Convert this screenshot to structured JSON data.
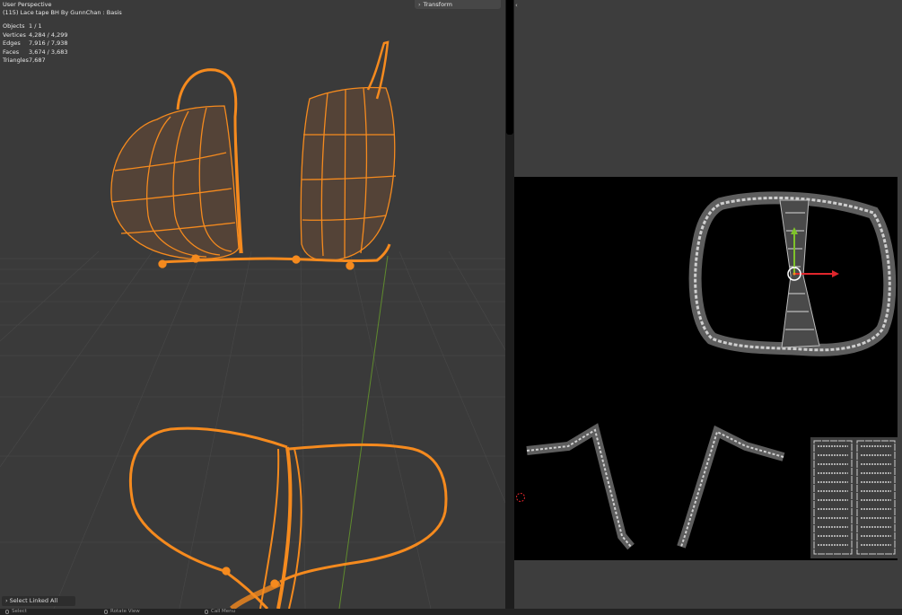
{
  "viewport": {
    "title": "User Perspective",
    "object_line": "(115) Lace tape BH By GunnChan : Basis",
    "stats": [
      {
        "label": "Objects",
        "value": "1 / 1"
      },
      {
        "label": "Vertices",
        "value": "4,284 / 4,299"
      },
      {
        "label": "Edges",
        "value": "7,916 / 7,938"
      },
      {
        "label": "Faces",
        "value": "3,674 / 3,683"
      },
      {
        "label": "Triangles",
        "value": "7,687"
      }
    ],
    "transform_label": "Transform",
    "operator_panel_label": "Select Linked All"
  },
  "uv_editor": {
    "toggle_glyph": "‹",
    "background_color": "#000000"
  },
  "statusbar": {
    "items": [
      {
        "label": "Select"
      },
      {
        "label": "Rotate View"
      },
      {
        "label": "Call Menu"
      }
    ]
  },
  "colors": {
    "selection_orange": "#f58a1e",
    "viewport_bg": "#3a3a3a",
    "gizmo_y": "#7fc22b",
    "gizmo_x": "#e0262c"
  }
}
